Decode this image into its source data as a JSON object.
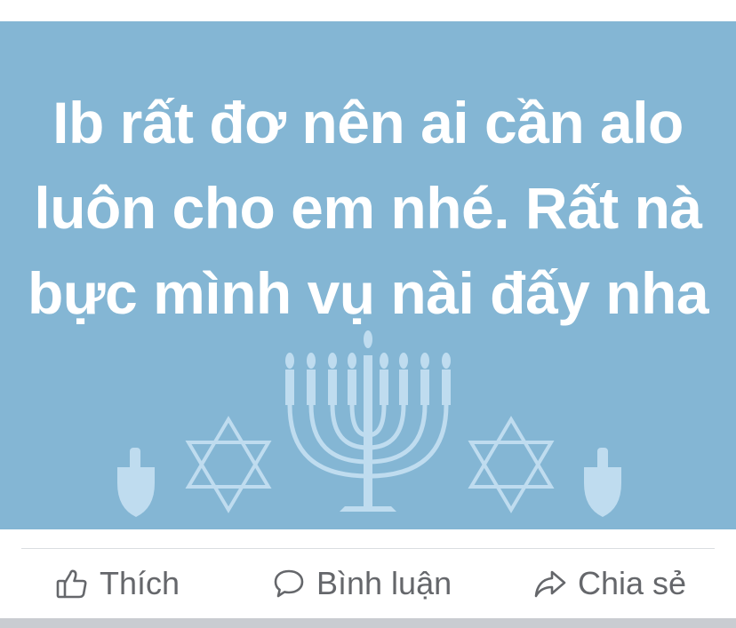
{
  "post": {
    "text": "Ib rất đơ nên ai cần alo luôn cho em nhé. Rất nà bực mình vụ nài đấy nha",
    "background_color": "#84b6d4",
    "decoration_color": "#bfdcef",
    "decorations": [
      "dreidel-icon",
      "star-of-david-icon",
      "menorah-icon",
      "star-of-david-icon",
      "dreidel-icon"
    ]
  },
  "actions": {
    "like": {
      "label": "Thích",
      "icon": "thumbs-up-icon"
    },
    "comment": {
      "label": "Bình luận",
      "icon": "speech-bubble-icon"
    },
    "share": {
      "label": "Chia sẻ",
      "icon": "share-arrow-icon"
    }
  }
}
